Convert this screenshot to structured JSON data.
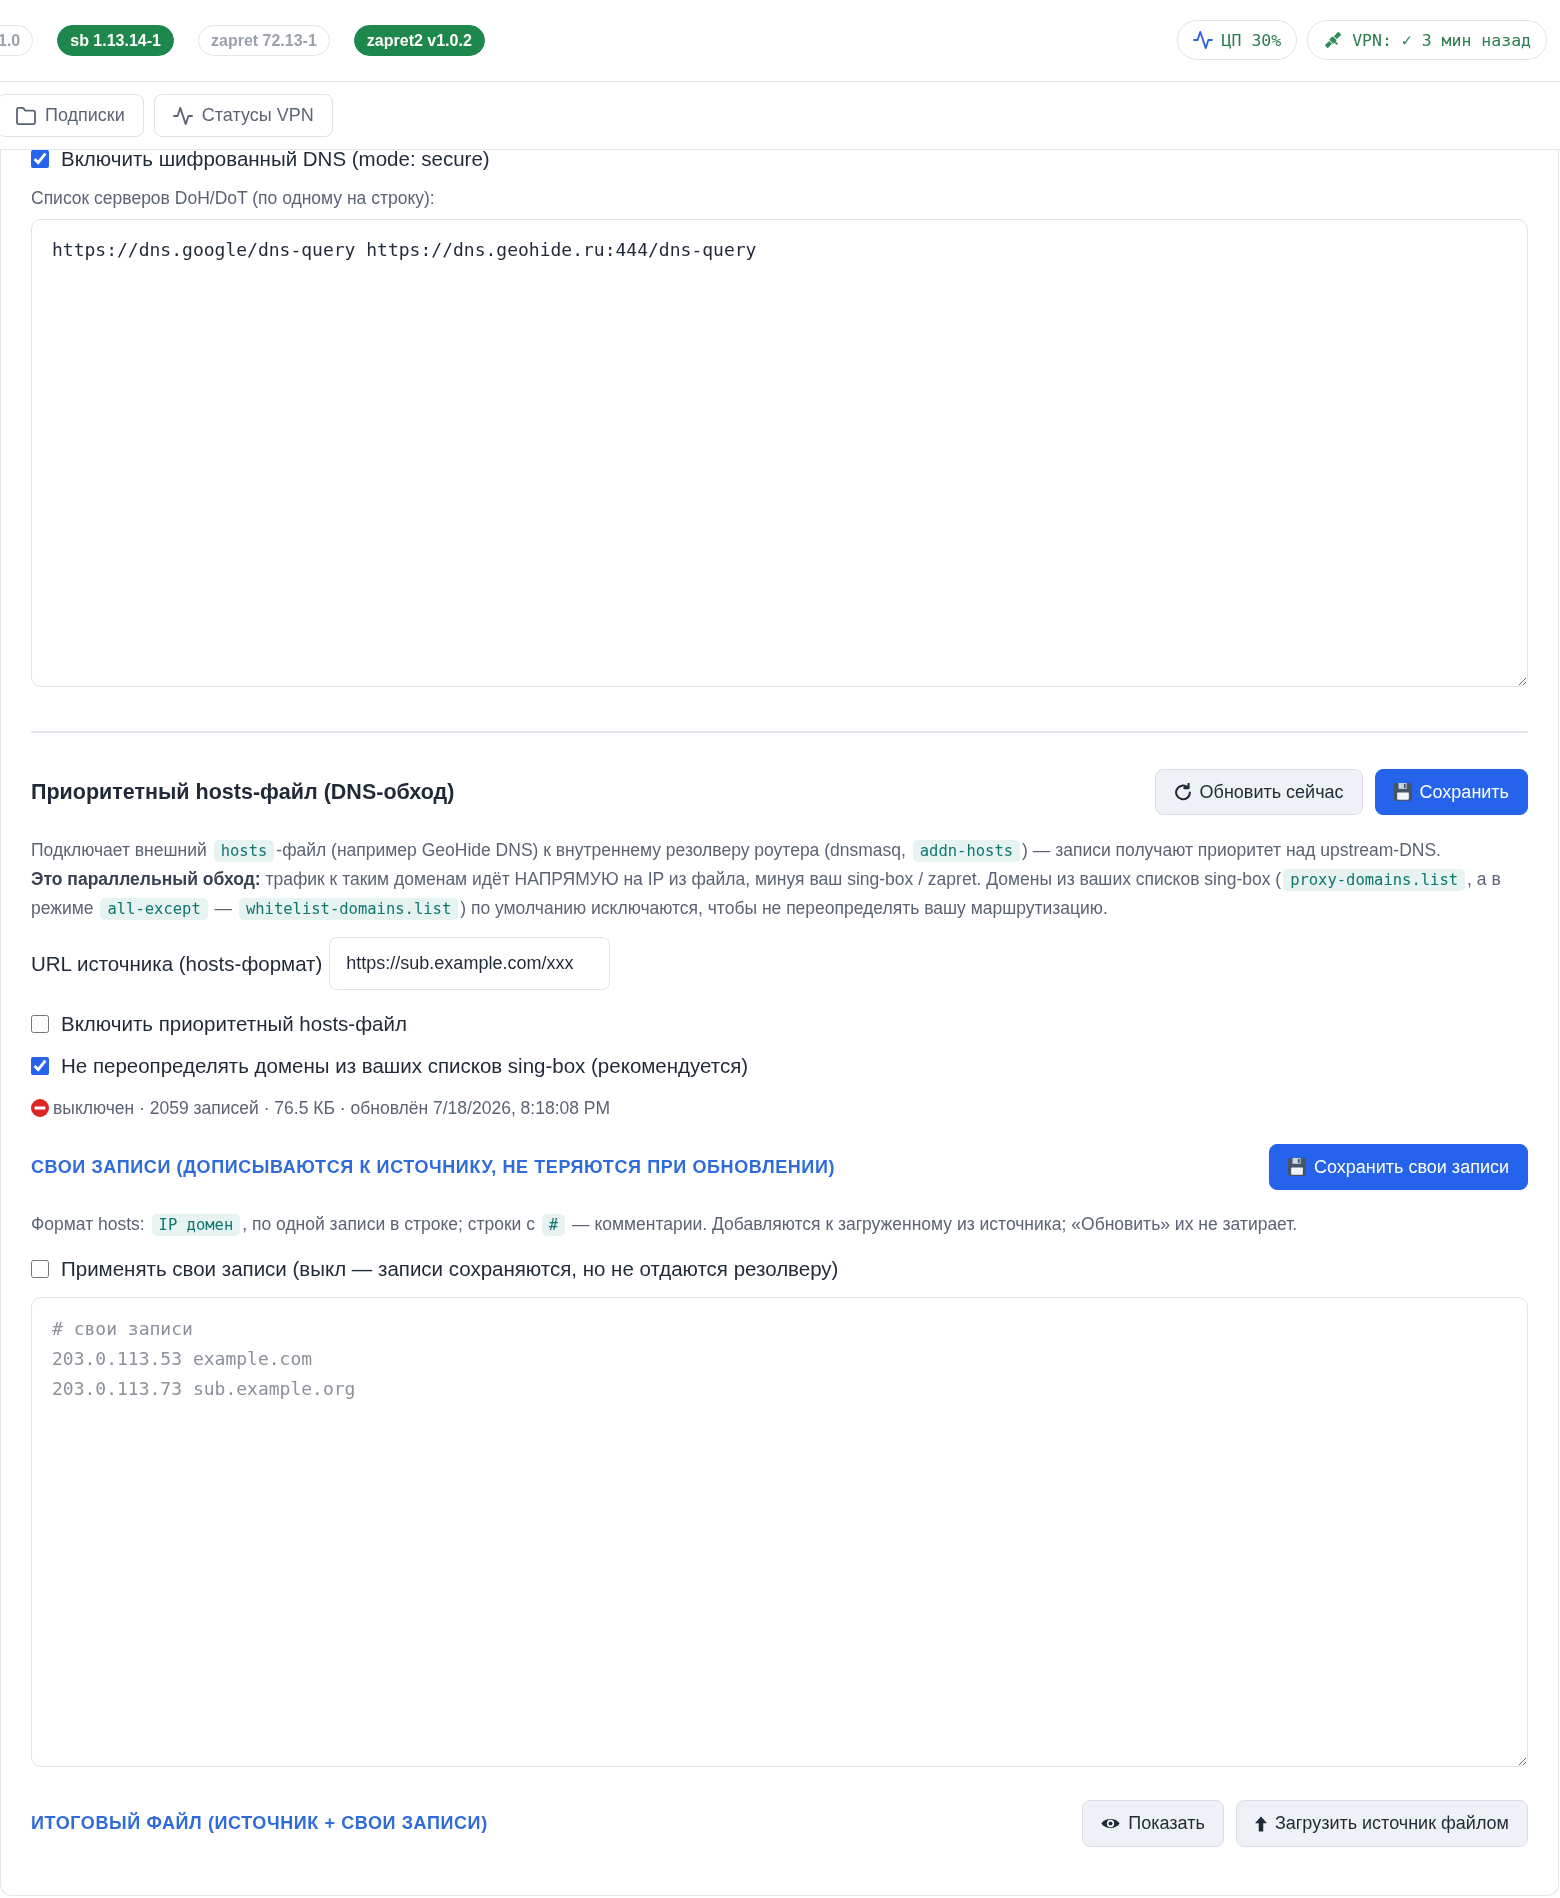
{
  "top_bar": {
    "badges": [
      {
        "label": "1.0",
        "active": false
      },
      {
        "label": "sb 1.13.14-1",
        "active": true
      },
      {
        "label": "zapret 72.13-1",
        "active": false
      },
      {
        "label": "zapret2 v1.0.2",
        "active": true
      }
    ],
    "indicators": [
      {
        "text": "ЦП 30%"
      },
      {
        "text": "VPN: ✓ 3 мин назад"
      }
    ]
  },
  "tabs": [
    {
      "label": "Подписки",
      "selected": false
    },
    {
      "label": "Статусы VPN",
      "selected": false
    }
  ],
  "encrypted_dns": {
    "checkbox": {
      "label": "Включить шифрованный DNS (mode: secure)",
      "checked": true
    },
    "servers_label": "Список серверов DoH/DoT (по одному на строку):",
    "servers": {
      "value": "https://dns.google/dns-query https://dns.geohide.ru:444/dns-query"
    }
  },
  "hosts_file": {
    "title": "Приоритетный hosts-файл (DNS-обход)",
    "buttons": [
      {
        "label": "Обновить сейчас",
        "kind": "secondary"
      },
      {
        "label": "Сохранить",
        "kind": "primary"
      }
    ],
    "description": [
      [
        {
          "kind": "text",
          "text": "Подключает внешний "
        },
        {
          "kind": "code",
          "text": "hosts"
        },
        {
          "kind": "text",
          "text": "-файл (например GeoHide DNS) к внутреннему резолверу роутера (dnsmasq, "
        },
        {
          "kind": "code",
          "text": "addn-hosts"
        },
        {
          "kind": "text",
          "text": ") — записи получают приоритет над upstream-DNS."
        }
      ],
      [
        {
          "kind": "text",
          "text": "**Это параллельный обход:** трафик к таким доменам идёт НАПРЯМУЮ на IP из файла, минуя ваш sing-box / zapret. Домены из ваших списков sing-box ("
        },
        {
          "kind": "code",
          "text": "proxy-domains.list"
        },
        {
          "kind": "text",
          "text": ", а в режиме "
        },
        {
          "kind": "code",
          "text": "all-except"
        },
        {
          "kind": "text",
          "text": " — "
        },
        {
          "kind": "code",
          "text": "whitelist-domains.list"
        },
        {
          "kind": "text",
          "text": ") по умолчанию исключаются, чтобы не переопределять вашу маршрутизацию."
        }
      ]
    ],
    "source_url": {
      "label": "URL источника (hosts-формат)",
      "value": "https://sub.example.com/xxx"
    },
    "options": [
      {
        "label": "Включить приоритетный hosts-файл",
        "checked": false
      },
      {
        "label": "Не переопределять домены из ваших списков sing-box (рекомендуется)",
        "checked": true
      }
    ],
    "status": {
      "enabled": false,
      "text": "выключен · 2059 записей · 76.5 КБ · обновлён 7/18/2026, 8:18:08 PM"
    }
  },
  "custom_entries": {
    "title": "СВОИ ЗАПИСИ (ДОПИСЫВАЮТСЯ К ИСТОЧНИКУ, НЕ ТЕРЯЮТСЯ ПРИ ОБНОВЛЕНИИ)",
    "button": {
      "label": "Сохранить свои записи",
      "kind": "primary"
    },
    "format": [
      {
        "kind": "text",
        "text": "Формат hosts: "
      },
      {
        "kind": "code",
        "text": "IP домен"
      },
      {
        "kind": "text",
        "text": ", по одной записи в строке; строки с "
      },
      {
        "kind": "code",
        "text": "#"
      },
      {
        "kind": "text",
        "text": " — комментарии. Добавляются к загруженному из источника; «Обновить» их не затирает."
      }
    ],
    "apply": {
      "label": "Применять свои записи (выкл — записи сохраняются, но не отдаются резолверу)",
      "checked": false
    },
    "editor": {
      "placeholder": "# свои записи\n203.0.113.53 example.com\n203.0.113.73 sub.example.org"
    }
  },
  "result_file": {
    "title": "ИТОГОВЫЙ ФАЙЛ (ИСТОЧНИК + СВОИ ЗАПИСИ)",
    "buttons": [
      {
        "label": "Показать",
        "kind": "secondary"
      },
      {
        "label": "Загрузить источник файлом",
        "kind": "secondary"
      }
    ]
  }
}
